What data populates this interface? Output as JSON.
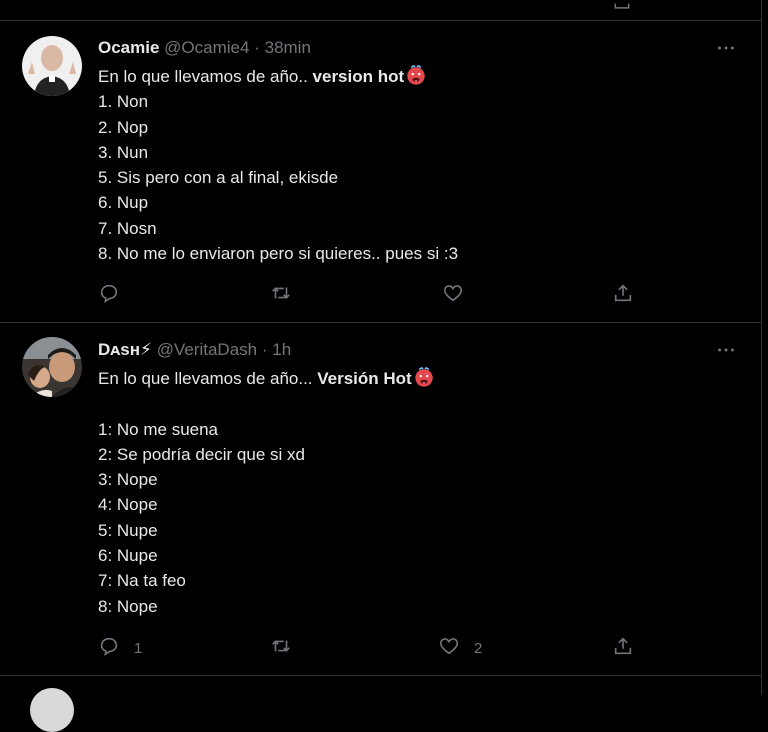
{
  "tweets": [
    {
      "name": "Ocamie",
      "handle": "@Ocamie4",
      "separator": "·",
      "time": "38min",
      "lines": [
        {
          "text": "En lo que llevamos de año.. ",
          "bold": "version hot",
          "emoji": "hot-face-emoji"
        },
        {
          "text": "1. Non"
        },
        {
          "text": "2. Nop"
        },
        {
          "text": "3. Nun"
        },
        {
          "text": "5. Sis pero con a al final, ekisde"
        },
        {
          "text": "6. Nup"
        },
        {
          "text": "7. Nosn"
        },
        {
          "text": "8. No me lo enviaron pero si quieres.. pues si :3"
        }
      ],
      "actions": {
        "reply_count": "",
        "retweet_count": "",
        "like_count": ""
      }
    },
    {
      "name": "Dᴀsʜ⚡",
      "handle": "@VeritaDash",
      "separator": "·",
      "time": "1h",
      "lines": [
        {
          "text": "En lo que llevamos de año... ",
          "bold": "Versión Hot",
          "emoji": "hot-face-emoji"
        },
        {
          "text": ""
        },
        {
          "text": "1: No me suena"
        },
        {
          "text": "2: Se podría decir que si xd"
        },
        {
          "text": "3: Nope"
        },
        {
          "text": "4: Nope"
        },
        {
          "text": "5: Nupe"
        },
        {
          "text": "6: Nupe"
        },
        {
          "text": "7: Na ta feo"
        },
        {
          "text": "8: Nope"
        }
      ],
      "actions": {
        "reply_count": "1",
        "retweet_count": "",
        "like_count": "2"
      }
    }
  ],
  "colors": {
    "background": "#000000",
    "text": "#e7e9ea",
    "muted": "#71767b",
    "border": "#2f3336",
    "emoji_red": "#e5484d"
  }
}
